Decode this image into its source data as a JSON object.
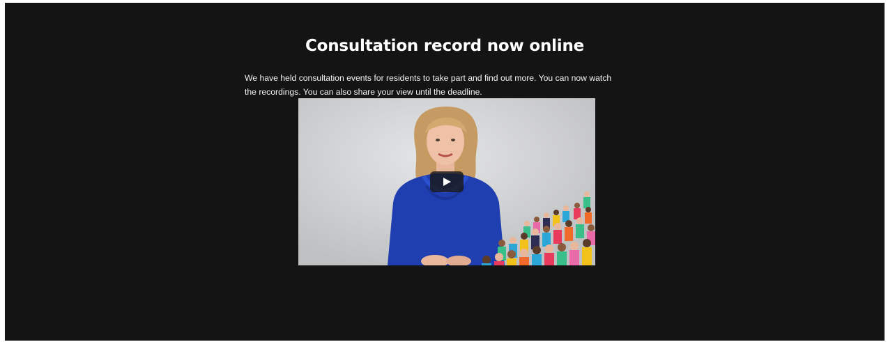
{
  "section": {
    "heading": "Consultation record now online",
    "intro_text": "We have held consultation events for residents to take part and find out more. You can now watch the recordings. You can also share your view until the deadline."
  },
  "video": {
    "play_icon": "play-icon",
    "colors": {
      "speaker_top": "#1f3fb0",
      "hair": "#c9a06a",
      "crowd": [
        "#e83a5a",
        "#2aa7d6",
        "#f2c21b",
        "#3bbf8a",
        "#f06a2a",
        "#2c2c54",
        "#e86aa8"
      ]
    }
  }
}
